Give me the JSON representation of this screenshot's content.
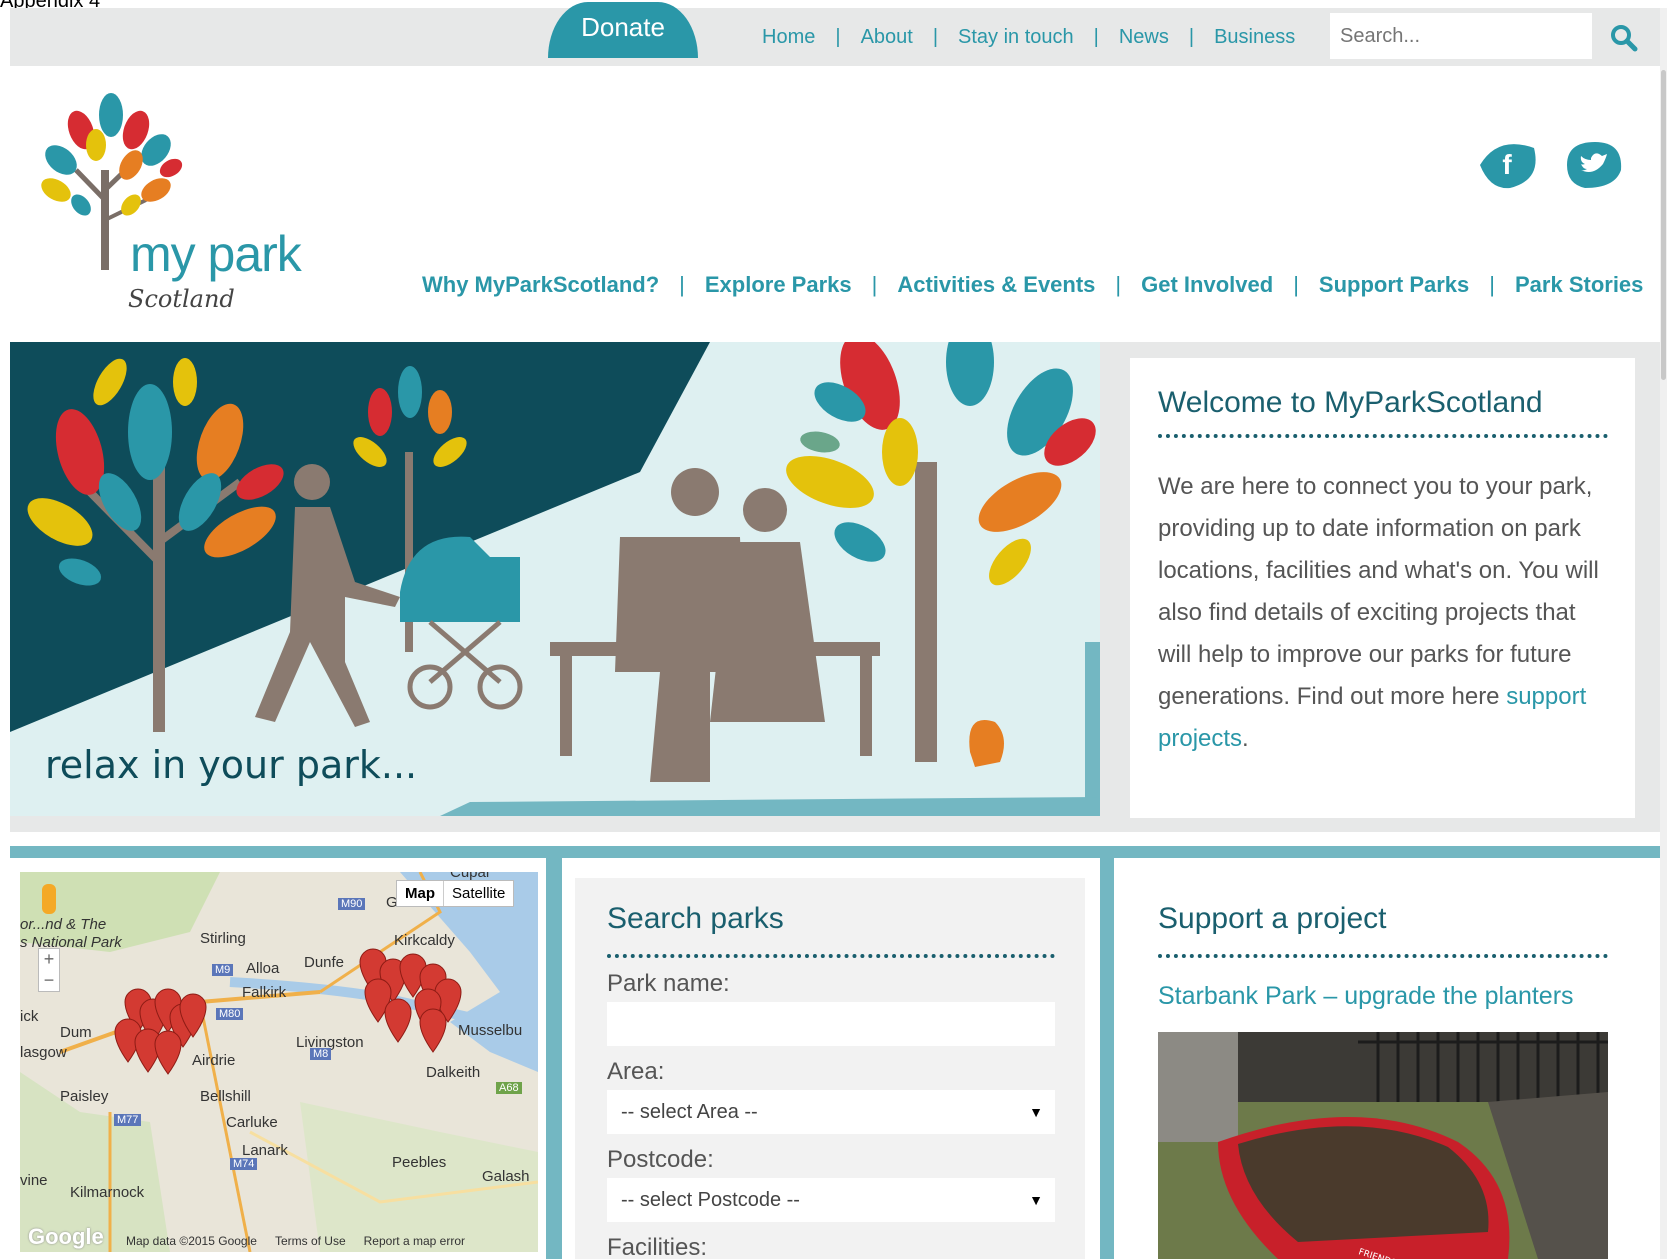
{
  "appendix": "Appendix 4",
  "topbar": {
    "donate": "Donate",
    "links": [
      "Home",
      "About",
      "Stay in touch",
      "News",
      "Business"
    ],
    "search_placeholder": "Search..."
  },
  "logo": {
    "main": "my park",
    "sub": "Scotland"
  },
  "social": [
    "facebook-icon",
    "twitter-icon"
  ],
  "mainnav": [
    "Why MyParkScotland?",
    "Explore Parks",
    "Activities & Events",
    "Get Involved",
    "Support Parks",
    "Park Stories"
  ],
  "hero": {
    "tagline": "relax in your park..."
  },
  "welcome": {
    "title": "Welcome to MyParkScotland",
    "body": "We are here to connect you to your park, providing up to date information on park locations, facilities and what's on. You will also find details of exciting projects that will help to improve our parks for future generations. Find out more here ",
    "link": "support projects",
    "end": "."
  },
  "map": {
    "buttons": [
      "Map",
      "Satellite"
    ],
    "zoom": [
      "+",
      "−"
    ],
    "labels": [
      "Stirling",
      "Kirkcaldy",
      "Alloa",
      "Dunfe",
      "Falkirk",
      "Livingston",
      "Musselbu",
      "Airdrie",
      "Dalkeith",
      "Paisley",
      "Bellshill",
      "Carluke",
      "Lanark",
      "Peebles",
      "Galash",
      "Kilmarnock",
      "Dum",
      "lasgow",
      "ick",
      "vine",
      "or...nd & The",
      "s National Park",
      "M90",
      "M9",
      "M80",
      "M8",
      "M77",
      "M74",
      "A68",
      "G",
      "Cupar"
    ],
    "footer": [
      "Map data ©2015 Google",
      "Terms of Use",
      "Report a map error"
    ],
    "brand": "Google"
  },
  "search_parks": {
    "title": "Search parks",
    "park_name_label": "Park name:",
    "park_name_value": "",
    "area_label": "Area:",
    "area_value": "-- select Area --",
    "postcode_label": "Postcode:",
    "postcode_value": "-- select Postcode --",
    "facilities_label": "Facilities:"
  },
  "support": {
    "title": "Support a project",
    "project": "Starbank Park – upgrade the planters"
  },
  "colors": {
    "accent": "#2a97a8",
    "dark_teal": "#1a5f6e",
    "band": "#73b7c2"
  }
}
